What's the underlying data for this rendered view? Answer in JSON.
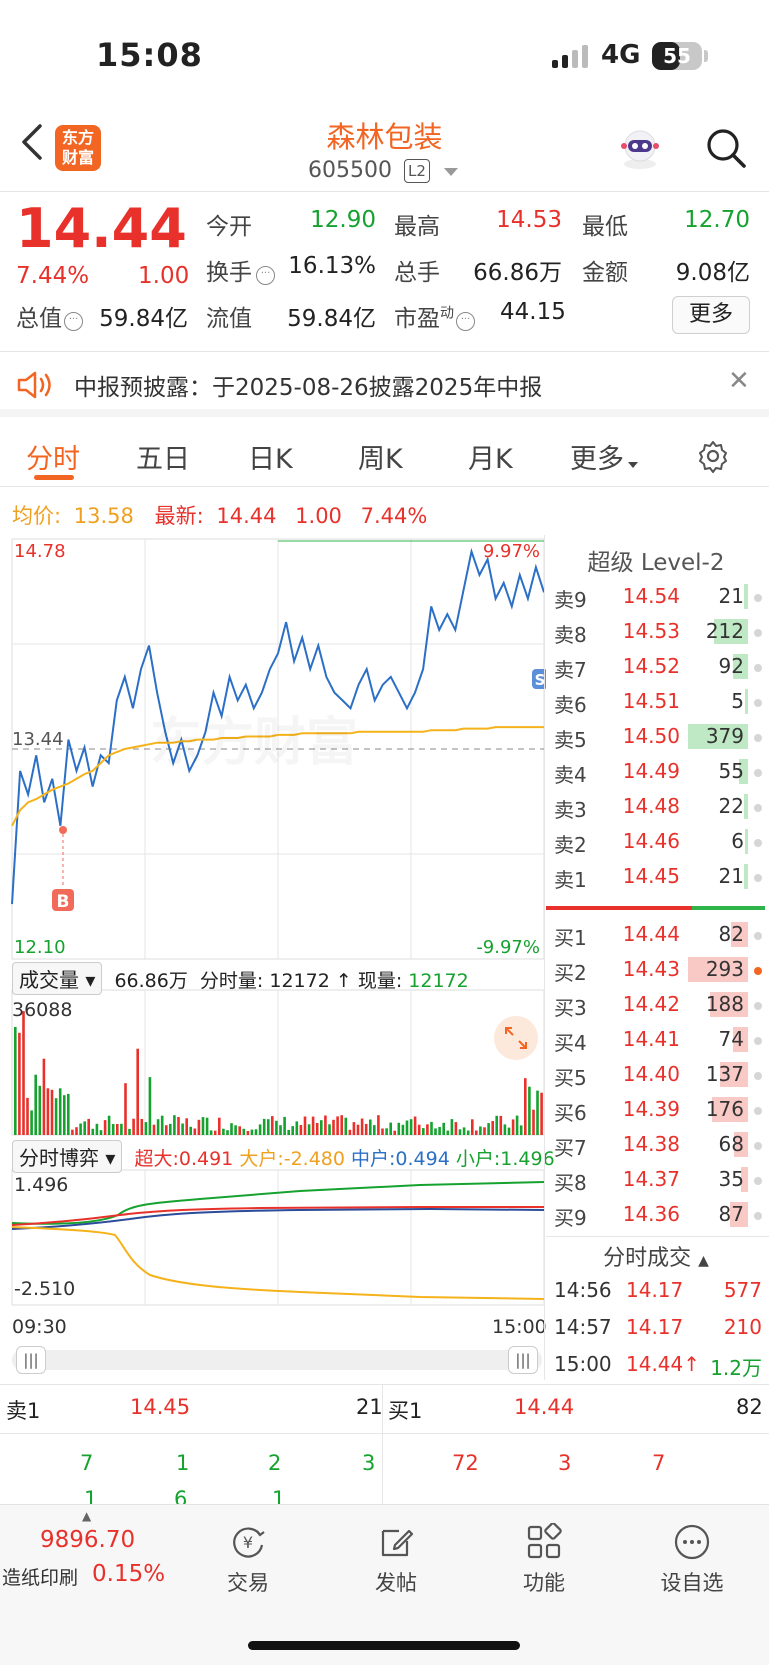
{
  "status_bar": {
    "time": "15:08",
    "network": "4G",
    "battery": "55",
    "battery_level": 0.55
  },
  "header": {
    "stock_name": "森林包装",
    "stock_code": "605500",
    "level_badge": "L2",
    "logo_text": "东方财富"
  },
  "quote": {
    "price": "14.44",
    "change_pct": "7.44%",
    "change": "1.00",
    "open_label": "今开",
    "open": "12.90",
    "high_label": "最高",
    "high": "14.53",
    "low_label": "最低",
    "low": "12.70",
    "turnover_label": "换手",
    "turnover": "16.13%",
    "volume_label": "总手",
    "volume": "66.86万",
    "amount_label": "金额",
    "amount": "9.08亿",
    "mktcap_label": "总值",
    "mktcap": "59.84亿",
    "float_label": "流值",
    "float_cap": "59.84亿",
    "pe_label": "市盈",
    "pe_sup": "动",
    "pe": "44.15",
    "more_button": "更多"
  },
  "notice": {
    "text": "中报预披露：于2025-08-26披露2025年中报"
  },
  "tabs": [
    "分时",
    "五日",
    "日K",
    "周K",
    "月K",
    "更多"
  ],
  "avg_row": {
    "avg_label": "均价:",
    "avg": "13.58",
    "last_label": "最新:",
    "last": "14.44",
    "change": "1.00",
    "change_pct": "7.44%"
  },
  "chart_labels": {
    "y_top": "14.78",
    "y_mid": "13.44",
    "y_bot": "12.10",
    "pct_top": "9.97%",
    "pct_bot": "-9.97%",
    "marker_b": "B",
    "marker_s": "S"
  },
  "chart_data": {
    "type": "line",
    "ylim": [
      12.1,
      14.78
    ],
    "prev_close": 13.44,
    "series": [
      {
        "values": [
          12.45,
          13.3,
          13.15,
          13.4,
          13.1,
          13.25,
          12.95,
          13.5,
          13.3,
          13.45,
          13.2,
          13.4,
          13.35,
          13.75,
          13.9,
          13.7,
          13.95,
          14.1,
          13.8,
          13.55,
          13.35,
          13.5,
          13.3,
          13.4,
          13.55,
          13.8,
          13.65,
          13.9,
          13.75,
          13.85,
          13.7,
          13.8,
          13.95,
          14.05,
          14.25,
          14.0,
          14.15,
          13.95,
          14.1,
          13.9,
          13.8,
          13.75,
          13.7,
          13.85,
          13.95,
          13.75,
          13.85,
          13.9,
          13.8,
          13.7,
          13.8,
          13.95,
          14.35,
          14.2,
          14.3,
          14.2,
          14.45,
          14.7,
          14.55,
          14.65,
          14.4,
          14.5,
          14.35,
          14.55,
          14.4,
          14.6,
          14.44
        ]
      },
      {
        "values": [
          12.95,
          13.05,
          13.1,
          13.12,
          13.15,
          13.18,
          13.2,
          13.22,
          13.25,
          13.28,
          13.3,
          13.35,
          13.4,
          13.42,
          13.44,
          13.45,
          13.46,
          13.47,
          13.48,
          13.48,
          13.48,
          13.49,
          13.49,
          13.5,
          13.5,
          13.5,
          13.51,
          13.51,
          13.51,
          13.52,
          13.52,
          13.52,
          13.52,
          13.53,
          13.53,
          13.53,
          13.54,
          13.54,
          13.54,
          13.54,
          13.54,
          13.54,
          13.54,
          13.55,
          13.55,
          13.55,
          13.55,
          13.55,
          13.55,
          13.55,
          13.55,
          13.55,
          13.56,
          13.56,
          13.56,
          13.56,
          13.57,
          13.57,
          13.57,
          13.57,
          13.58,
          13.58,
          13.58,
          13.58,
          13.58,
          13.58,
          13.58
        ]
      }
    ]
  },
  "volume": {
    "selector": "成交量",
    "total": "66.86万",
    "tick_label": "分时量:",
    "tick_vol": "12172",
    "now_label": "现量:",
    "now_vol": "12172",
    "y_max": "36088"
  },
  "game": {
    "selector": "分时博弈",
    "super_label": "超大:",
    "super": "0.491",
    "big_label": "大户:",
    "big": "-2.480",
    "mid_label": "中户:",
    "mid": "0.494",
    "small_label": "小户:",
    "small": "1.496",
    "y_top": "1.496",
    "y_bot": "-2.510"
  },
  "time_axis": {
    "start": "09:30",
    "end": "15:00"
  },
  "level2": {
    "title": "超级 Level-2",
    "asks": [
      {
        "label": "卖9",
        "price": "14.54",
        "vol": "21",
        "level": 0.06
      },
      {
        "label": "卖8",
        "price": "14.53",
        "vol": "212",
        "level": 0.56
      },
      {
        "label": "卖7",
        "price": "14.52",
        "vol": "92",
        "level": 0.25
      },
      {
        "label": "卖6",
        "price": "14.51",
        "vol": "5",
        "level": 0.02
      },
      {
        "label": "卖5",
        "price": "14.50",
        "vol": "379",
        "level": 1.0
      },
      {
        "label": "卖4",
        "price": "14.49",
        "vol": "55",
        "level": 0.15
      },
      {
        "label": "卖3",
        "price": "14.48",
        "vol": "22",
        "level": 0.06
      },
      {
        "label": "卖2",
        "price": "14.46",
        "vol": "6",
        "level": 0.02
      },
      {
        "label": "卖1",
        "price": "14.45",
        "vol": "21",
        "level": 0.06
      }
    ],
    "bids": [
      {
        "label": "买1",
        "price": "14.44",
        "vol": "82",
        "level": 0.28
      },
      {
        "label": "买2",
        "price": "14.43",
        "vol": "293",
        "level": 1.0
      },
      {
        "label": "买3",
        "price": "14.42",
        "vol": "188",
        "level": 0.64
      },
      {
        "label": "买4",
        "price": "14.41",
        "vol": "74",
        "level": 0.25
      },
      {
        "label": "买5",
        "price": "14.40",
        "vol": "137",
        "level": 0.47
      },
      {
        "label": "买6",
        "price": "14.39",
        "vol": "176",
        "level": 0.6
      },
      {
        "label": "买7",
        "price": "14.38",
        "vol": "68",
        "level": 0.23
      },
      {
        "label": "买8",
        "price": "14.37",
        "vol": "35",
        "level": 0.12
      },
      {
        "label": "买9",
        "price": "14.36",
        "vol": "87",
        "level": 0.3
      }
    ],
    "ticks_title": "分时成交",
    "ticks": [
      {
        "time": "14:56",
        "price": "14.17",
        "vol": "577"
      },
      {
        "time": "14:57",
        "price": "14.17",
        "vol": "210"
      },
      {
        "time": "15:00",
        "price": "14.44↑",
        "vol": "1.2万"
      }
    ]
  },
  "quick_book": {
    "ask_label": "卖1",
    "ask_price": "14.45",
    "ask_vol": "21",
    "bid_label": "买1",
    "bid_price": "14.44",
    "bid_vol": "82",
    "ask_queue_1": [
      "7",
      "1",
      "2",
      "3"
    ],
    "ask_queue_2": [
      "1",
      "6",
      "1"
    ],
    "bid_queue": [
      "72",
      "3",
      "7"
    ]
  },
  "bottom_nav": {
    "index_value": "9896.70",
    "index_name": "造纸印刷",
    "index_pct": "0.15%",
    "items": [
      "交易",
      "发帖",
      "功能",
      "设自选"
    ]
  }
}
